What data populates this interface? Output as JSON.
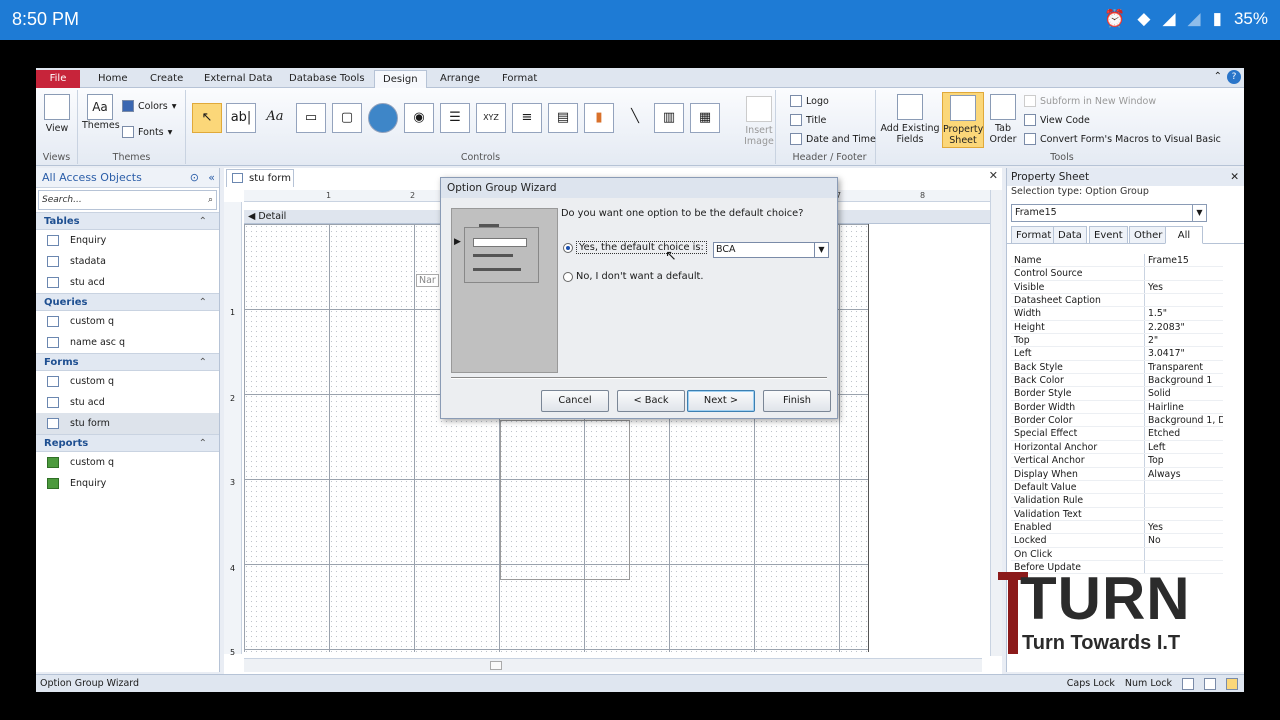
{
  "status_bar": {
    "time": "8:50 PM",
    "battery": "35%"
  },
  "ribbon": {
    "tabs": [
      "File",
      "Home",
      "Create",
      "External Data",
      "Database Tools",
      "Design",
      "Arrange",
      "Format"
    ],
    "groups": {
      "views": {
        "label": "Views",
        "view": "View"
      },
      "themes": {
        "label": "Themes",
        "themes": "Themes",
        "colors": "Colors",
        "fonts": "Fonts"
      },
      "controls": {
        "label": "Controls",
        "insert_image": "Insert Image"
      },
      "header_footer": {
        "label": "Header / Footer",
        "logo": "Logo",
        "title": "Title",
        "date_time": "Date and Time"
      },
      "tools": {
        "label": "Tools",
        "add_existing": "Add Existing Fields",
        "property_sheet": "Property Sheet",
        "tab_order": "Tab Order",
        "subform": "Subform in New Window",
        "view_code": "View Code",
        "convert": "Convert Form's Macros to Visual Basic"
      }
    }
  },
  "nav": {
    "title": "All Access Objects",
    "search_placeholder": "Search...",
    "sections": [
      {
        "name": "Tables",
        "items": [
          "Enquiry",
          "stadata",
          "stu acd"
        ]
      },
      {
        "name": "Queries",
        "items": [
          "custom q",
          "name asc q"
        ]
      },
      {
        "name": "Forms",
        "items": [
          "custom q",
          "stu acd",
          "stu form"
        ]
      },
      {
        "name": "Reports",
        "items": [
          "custom q",
          "Enquiry"
        ]
      }
    ]
  },
  "document": {
    "tab": "stu form",
    "section": "Detail",
    "ghost_label": "Nar"
  },
  "wizard": {
    "title": "Option Group Wizard",
    "question": "Do you want one option to be the default choice?",
    "option_yes": "Yes, the default choice is:",
    "option_no": "No, I don't want a default.",
    "default_value": "BCA",
    "buttons": {
      "cancel": "Cancel",
      "back": "< Back",
      "next": "Next >",
      "finish": "Finish"
    }
  },
  "property_sheet": {
    "title": "Property Sheet",
    "selection_type": "Selection type:  Option Group",
    "object": "Frame15",
    "tabs": [
      "Format",
      "Data",
      "Event",
      "Other",
      "All"
    ],
    "rows": [
      [
        "Name",
        "Frame15"
      ],
      [
        "Control Source",
        ""
      ],
      [
        "Visible",
        "Yes"
      ],
      [
        "Datasheet Caption",
        ""
      ],
      [
        "Width",
        "1.5\""
      ],
      [
        "Height",
        "2.2083\""
      ],
      [
        "Top",
        "2\""
      ],
      [
        "Left",
        "3.0417\""
      ],
      [
        "Back Style",
        "Transparent"
      ],
      [
        "Back Color",
        "Background 1"
      ],
      [
        "Border Style",
        "Solid"
      ],
      [
        "Border Width",
        "Hairline"
      ],
      [
        "Border Color",
        "Background 1, D"
      ],
      [
        "Special Effect",
        "Etched"
      ],
      [
        "Horizontal Anchor",
        "Left"
      ],
      [
        "Vertical Anchor",
        "Top"
      ],
      [
        "Display When",
        "Always"
      ],
      [
        "Default Value",
        ""
      ],
      [
        "Validation Rule",
        ""
      ],
      [
        "Validation Text",
        ""
      ],
      [
        "Enabled",
        "Yes"
      ],
      [
        "Locked",
        "No"
      ],
      [
        "On Click",
        ""
      ],
      [
        "Before Update",
        ""
      ]
    ]
  },
  "status": {
    "left": "Option Group Wizard",
    "caps": "Caps Lock",
    "num": "Num Lock"
  },
  "watermark": {
    "big": "TURN",
    "sub": "Turn Towards I.T"
  }
}
